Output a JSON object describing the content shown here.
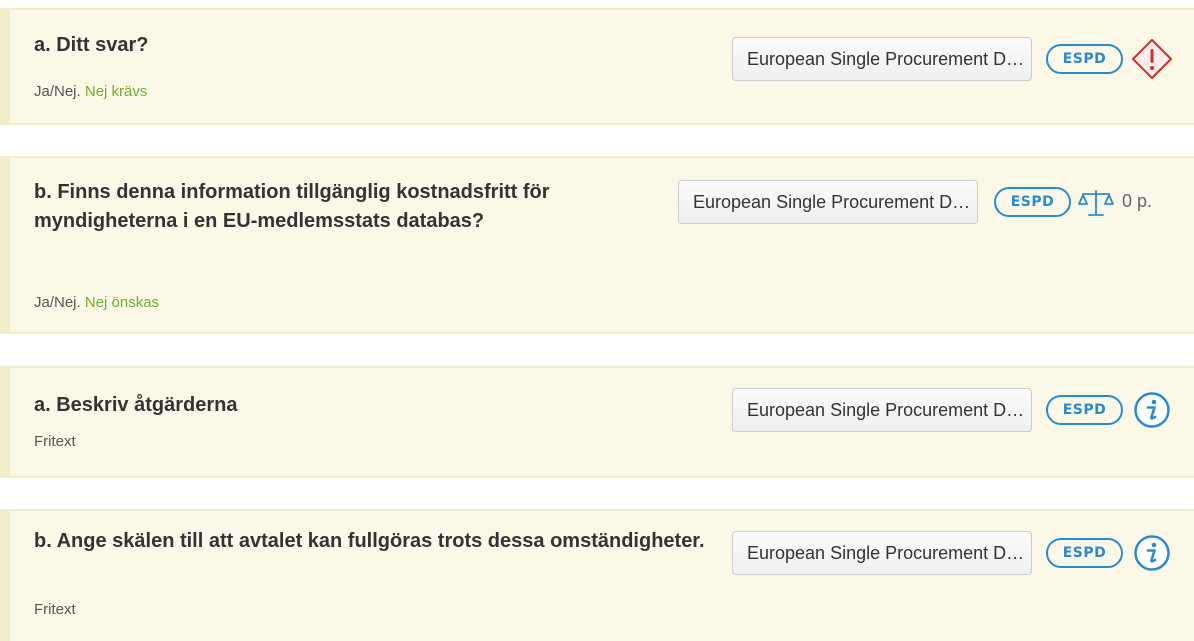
{
  "questions": [
    {
      "title": "a. Ditt svar?",
      "sub_prefix": "Ja/Nej.",
      "sub_hint": "Nej krävs",
      "doc_button": "European Single Procurement Document",
      "badge": "ESPD",
      "icon": "warning-diamond-icon"
    },
    {
      "title": "b. Finns denna information tillgänglig kostnadsfritt för myndigheterna i en EU-medlemsstats databas?",
      "sub_prefix": "Ja/Nej.",
      "sub_hint": "Nej önskas",
      "doc_button": "European Single Procurement Document",
      "badge": "ESPD",
      "icon": "scales-icon",
      "points": "0 p."
    },
    {
      "title": "a. Beskriv åtgärderna",
      "sub_prefix": "Fritext",
      "doc_button": "European Single Procurement Document",
      "badge": "ESPD",
      "icon": "info-icon"
    },
    {
      "title": "b. Ange skälen till att avtalet kan fullgöras trots dessa omständigheter.",
      "sub_prefix": "Fritext",
      "doc_button": "European Single Procurement Document",
      "badge": "ESPD",
      "icon": "info-icon"
    }
  ],
  "colors": {
    "card_bg": "#fcf8e8",
    "card_border": "#f3edc9",
    "hint_green": "#6fae2b",
    "espd_blue": "#2a8ad0",
    "warning_red": "#c9302c",
    "info_blue": "#2a8ad0"
  }
}
